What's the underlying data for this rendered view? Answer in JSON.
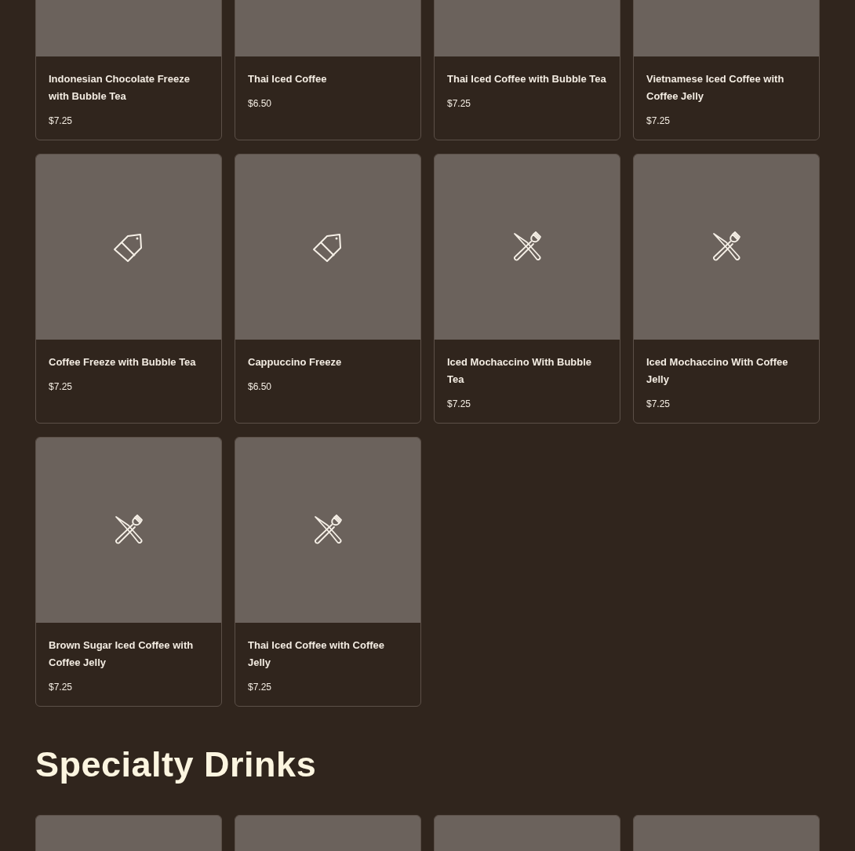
{
  "sections": [
    {
      "items": [
        {
          "kind": "product",
          "name": "Indonesian Chocolate Freeze with Bubble Tea",
          "price": "$7.25"
        },
        {
          "kind": "product",
          "name": "Thai Iced Coffee",
          "price": "$6.50"
        },
        {
          "kind": "product",
          "name": "Thai Iced Coffee with Bubble Tea",
          "price": "$7.25"
        },
        {
          "kind": "product",
          "name": "Vietnamese Iced Coffee with Coffee Jelly",
          "price": "$7.25"
        },
        {
          "kind": "tag",
          "name": "Coffee Freeze with Bubble Tea",
          "price": "$7.25"
        },
        {
          "kind": "tag",
          "name": "Cappuccino Freeze",
          "price": "$6.50"
        },
        {
          "kind": "dish",
          "name": "Iced Mochaccino With Bubble Tea",
          "price": "$7.25"
        },
        {
          "kind": "dish",
          "name": "Iced Mochaccino With Coffee Jelly",
          "price": "$7.25"
        },
        {
          "kind": "dish",
          "name": "Brown Sugar Iced Coffee with Coffee Jelly",
          "price": "$7.25"
        },
        {
          "kind": "dish",
          "name": "Thai Iced Coffee with Coffee Jelly",
          "price": "$7.25"
        }
      ]
    },
    {
      "title": "Specialty Drinks",
      "items": [
        {
          "kind": "placeholder"
        },
        {
          "kind": "placeholder"
        },
        {
          "kind": "placeholder"
        },
        {
          "kind": "placeholder"
        }
      ]
    }
  ]
}
